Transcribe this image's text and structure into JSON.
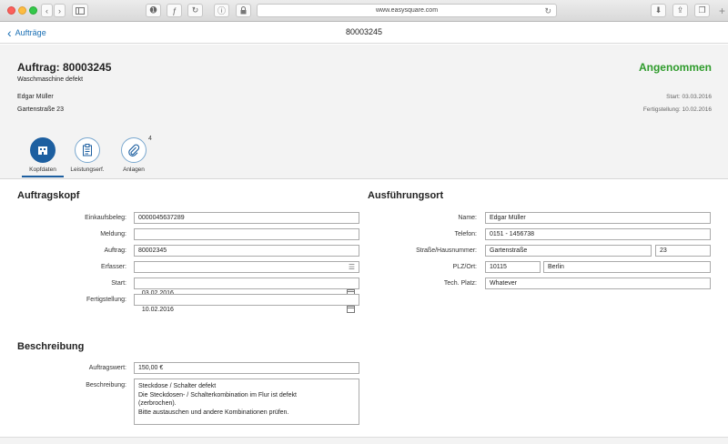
{
  "browser": {
    "url": "www.easysquare.com"
  },
  "nav": {
    "back_label": "Aufträge",
    "title": "80003245"
  },
  "header": {
    "title": "Auftrag: 80003245",
    "subtitle": "Waschmaschine defekt",
    "customer": "Edgar Müller",
    "address": "Gartenstraße 23",
    "status": "Angenommen",
    "status_color": "#2e9b2b",
    "start": "Start: 03.03.2016",
    "fertigstellung": "Fertigstellung: 10.02.2016"
  },
  "tabs": [
    {
      "label": "Kopfdaten",
      "icon": "building-icon",
      "active": true
    },
    {
      "label": "Leistungserf.",
      "icon": "clipboard-icon",
      "active": false
    },
    {
      "label": "Anlagen",
      "icon": "paperclip-icon",
      "active": false,
      "badge": "4"
    }
  ],
  "auftragskopf": {
    "title": "Auftragskopf",
    "fields": [
      {
        "label": "Einkaufsbeleg:",
        "value": "0000045637289"
      },
      {
        "label": "Meldung:",
        "value": ""
      },
      {
        "label": "Auftrag:",
        "value": "80002345"
      },
      {
        "label": "Erfasser:",
        "value": "",
        "icon": "list-icon"
      },
      {
        "label": "Start:",
        "value": "03.02.2016",
        "icon": "calendar-icon"
      },
      {
        "label": "Fertigstellung:",
        "value": "10.02.2016",
        "icon": "calendar-icon"
      }
    ]
  },
  "ausfuehrungsort": {
    "title": "Ausführungsort",
    "name_label": "Name:",
    "name_value": "Edgar Müller",
    "telefon_label": "Telefon:",
    "telefon_value": "0151 - 1456738",
    "strasse_label": "Straße/Hausnummer:",
    "strasse_value": "Gartenstraße",
    "hausnummer_value": "23",
    "plz_label": "PLZ/Ort:",
    "plz_value": "10115",
    "ort_value": "Berlin",
    "techplatz_label": "Tech. Platz:",
    "techplatz_value": "Whatever"
  },
  "beschreibung": {
    "title": "Beschreibung",
    "wert_label": "Auftragswert:",
    "wert_value": "150,00 €",
    "text_label": "Beschreibung:",
    "text_value": "Steckdose / Schalter defekt\nDie Steckdosen- / Schalterkombination im Flur ist defekt\n(zerbrochen).\nBitte austauschen und andere Kombinationen prüfen."
  },
  "colors": {
    "accent": "#1d5fa0",
    "link": "#1a6fb4"
  }
}
